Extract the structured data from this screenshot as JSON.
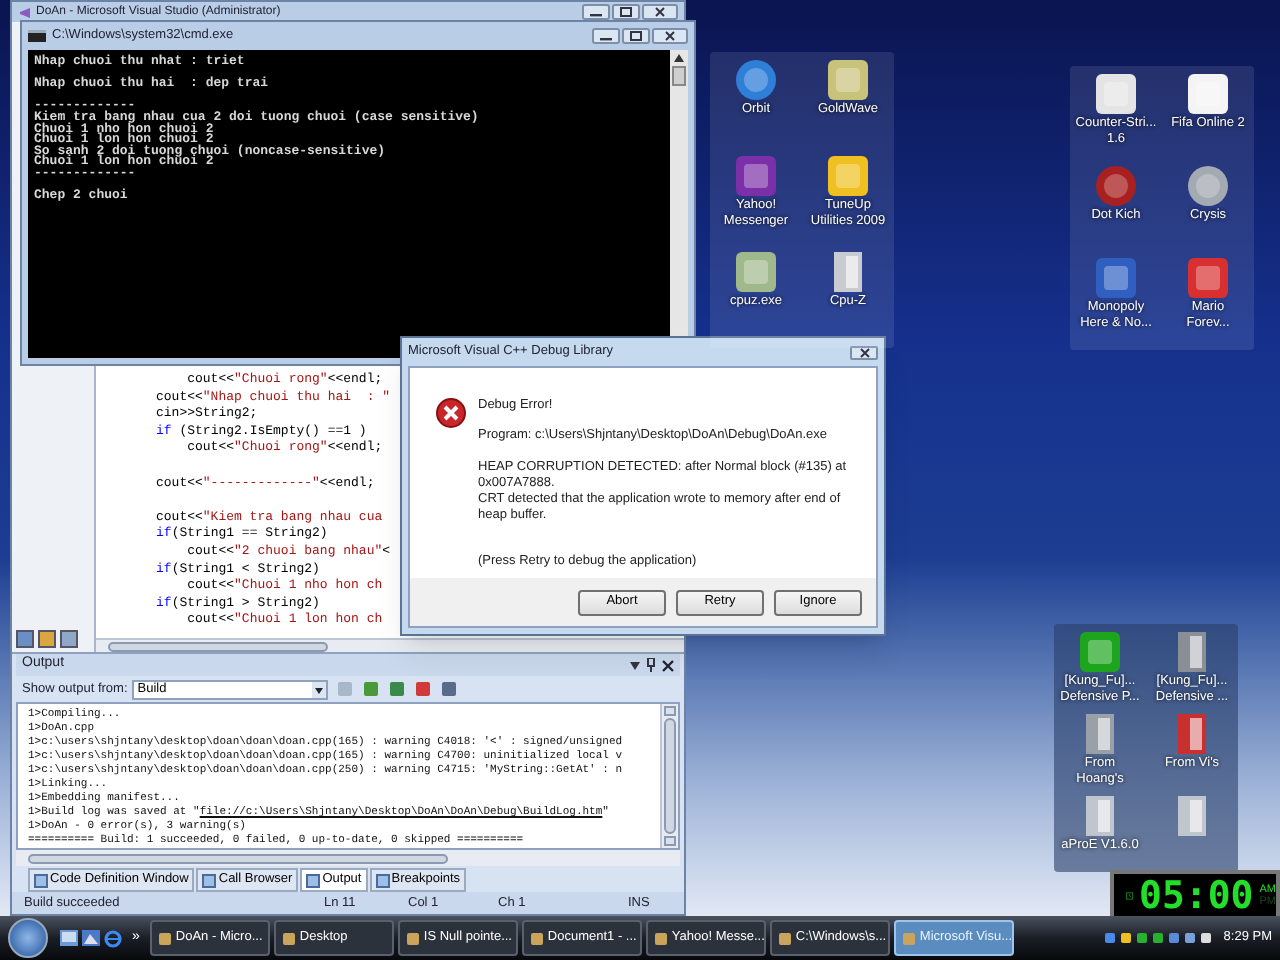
{
  "ide_window": {
    "title": "DoAn - Microsoft Visual Studio (Administrator)",
    "editor": {
      "blocks": [
        [
          [
            {
              "kind": "plain",
              "text": "    cout<<"
            },
            {
              "kind": "string",
              "text": "\"Chuoi rong\""
            },
            {
              "kind": "plain",
              "text": "<<endl;"
            }
          ],
          [
            {
              "kind": "plain",
              "text": "cout<<"
            },
            {
              "kind": "string",
              "text": "\"Nhap chuoi thu hai  : \""
            }
          ],
          [
            {
              "kind": "plain",
              "text": "cin>>String2;"
            }
          ],
          [
            {
              "kind": "keyword",
              "text": "if"
            },
            {
              "kind": "plain",
              "text": " (String2.IsEmpty() ==1 )"
            }
          ],
          [
            {
              "kind": "plain",
              "text": "    cout<<"
            },
            {
              "kind": "string",
              "text": "\"Chuoi rong\""
            },
            {
              "kind": "plain",
              "text": "<<endl;"
            }
          ]
        ],
        [
          [
            {
              "kind": "plain",
              "text": "cout<<"
            },
            {
              "kind": "string",
              "text": "\"-------------\""
            },
            {
              "kind": "plain",
              "text": "<<endl;"
            }
          ]
        ],
        [
          [
            {
              "kind": "plain",
              "text": "cout<<"
            },
            {
              "kind": "string",
              "text": "\"Kiem tra bang nhau cua"
            }
          ],
          [
            {
              "kind": "keyword",
              "text": "if"
            },
            {
              "kind": "plain",
              "text": "(String1 == String2)"
            }
          ],
          [
            {
              "kind": "plain",
              "text": "    cout<<"
            },
            {
              "kind": "string",
              "text": "\"2 chuoi bang nhau\""
            },
            {
              "kind": "plain",
              "text": "<"
            }
          ],
          [
            {
              "kind": "keyword",
              "text": "if"
            },
            {
              "kind": "plain",
              "text": "(String1 < String2)"
            }
          ],
          [
            {
              "kind": "plain",
              "text": "    cout<<"
            },
            {
              "kind": "string",
              "text": "\"Chuoi 1 nho hon ch"
            }
          ],
          [
            {
              "kind": "keyword",
              "text": "if"
            },
            {
              "kind": "plain",
              "text": "(String1 > String2)"
            }
          ],
          [
            {
              "kind": "plain",
              "text": "    cout<<"
            },
            {
              "kind": "string",
              "text": "\"Chuoi 1 lon hon ch"
            }
          ]
        ]
      ]
    },
    "output": {
      "title": "Output",
      "source_label": "Show output from:",
      "source": "Build",
      "lines": [
        {
          "kind": "text",
          "text": "1>Compiling..."
        },
        {
          "kind": "text",
          "text": "1>DoAn.cpp"
        },
        {
          "kind": "text",
          "text": "1>c:\\users\\shjntany\\desktop\\doan\\doan\\doan.cpp(165) : warning C4018: '<' : signed/unsigned"
        },
        {
          "kind": "text",
          "text": "1>c:\\users\\shjntany\\desktop\\doan\\doan\\doan.cpp(165) : warning C4700: uninitialized local v"
        },
        {
          "kind": "text",
          "text": "1>c:\\users\\shjntany\\desktop\\doan\\doan\\doan.cpp(250) : warning C4715: 'MyString::GetAt' : n"
        },
        {
          "kind": "text",
          "text": "1>Linking..."
        },
        {
          "kind": "text",
          "text": "1>Embedding manifest..."
        },
        {
          "kind": "link",
          "prefix": "1>Build log was saved at \"",
          "link": "file://c:\\Users\\Shjntany\\Desktop\\DoAn\\DoAn\\Debug\\BuildLog.htm",
          "suffix": "\""
        },
        {
          "kind": "text",
          "text": "1>DoAn - 0 error(s), 3 warning(s)"
        },
        {
          "kind": "text",
          "text": "========== Build: 1 succeeded, 0 failed, 0 up-to-date, 0 skipped =========="
        }
      ],
      "tabs": [
        {
          "label": "Code Definition Window",
          "selected": false
        },
        {
          "label": "Call Browser",
          "selected": false
        },
        {
          "label": "Output",
          "selected": true
        },
        {
          "label": "Breakpoints",
          "selected": false
        }
      ]
    },
    "status_bar": [
      "Build succeeded",
      "Ln 11",
      "Col 1",
      "Ch 1",
      "INS"
    ]
  },
  "console": {
    "title": "C:\\Windows\\system32\\cmd.exe",
    "blocks": [
      [
        "Nhap chuoi thu nhat : triet"
      ],
      [
        "Nhap chuoi thu hai  : dep trai"
      ],
      [
        "-------------",
        "Kiem tra bang nhau cua 2 doi tuong chuoi (case sensitive)",
        "Chuoi 1 nho hon chuoi 2",
        "Chuoi 1 lon hon chuoi 2",
        "So sanh 2 doi tuong chuoi (noncase-sensitive)",
        "Chuoi 1 lon hon chuoi 2",
        "-------------"
      ],
      [
        "Chep 2 chuoi"
      ]
    ]
  },
  "dialog": {
    "title": "Microsoft Visual C++ Debug Library",
    "heading": "Debug Error!",
    "program": "Program: c:\\Users\\Shjntany\\Desktop\\DoAn\\Debug\\DoAn.exe",
    "message": [
      "HEAP CORRUPTION DETECTED: after Normal block (#135) at 0x007A7888.",
      "CRT detected that the application wrote to memory after end of heap buffer."
    ],
    "hint": "(Press Retry to debug the application)",
    "buttons": [
      "Abort",
      "Retry",
      "Ignore"
    ]
  },
  "desktop_groups": [
    {
      "items": [
        {
          "label": "Orbit",
          "kind": "circle",
          "color": "#2f7fd8"
        },
        {
          "label": "GoldWave",
          "kind": "tile",
          "color": "#c9c27a"
        },
        {
          "label": "Yahoo!\nMessenger",
          "kind": "tile",
          "color": "#7b2fa8"
        },
        {
          "label": "TuneUp\nUtilities 2009",
          "kind": "tile",
          "color": "#f0c020"
        },
        {
          "label": "cpuz.exe",
          "kind": "tile",
          "color": "#9fb98a"
        },
        {
          "label": "Cpu-Z",
          "kind": "folder",
          "color": "#c8ccd2"
        }
      ]
    },
    {
      "items": [
        {
          "label": "Counter-Stri...\n1.6",
          "kind": "tile",
          "color": "#e4e4e4"
        },
        {
          "label": "Fifa Online 2",
          "kind": "tile",
          "color": "#f4f4f4"
        },
        {
          "label": "Dot Kich",
          "kind": "circle",
          "color": "#a82020"
        },
        {
          "label": "Crysis",
          "kind": "circle",
          "color": "#a4aab2"
        },
        {
          "label": "Monopoly\nHere & No...",
          "kind": "tile",
          "color": "#2f5fc0"
        },
        {
          "label": "Mario\nForev...",
          "kind": "tile",
          "color": "#d83030"
        }
      ]
    },
    {
      "items": [
        {
          "label": "[Kung_Fu]...\nDefensive P...",
          "kind": "tile",
          "color": "#1ea51e"
        },
        {
          "label": "[Kung_Fu]...\nDefensive ...",
          "kind": "folder",
          "color": "#8a8f96"
        },
        {
          "label": "From\nHoang's",
          "kind": "folder",
          "color": "#9aa0a8"
        },
        {
          "label": "From Vi's",
          "kind": "folder",
          "color": "#c83030"
        },
        {
          "label": "aProE V1.6.0",
          "kind": "folder",
          "color": "#c0c6ce"
        },
        {
          "kind": "folder",
          "color": "#c0c6ce"
        }
      ]
    }
  ],
  "clock": {
    "time": "05:00",
    "periods": [
      {
        "label": "AM",
        "selected": true
      },
      {
        "label": "PM",
        "selected": false
      }
    ]
  },
  "taskbar": {
    "more": "»",
    "buttons": [
      {
        "label": "DoAn - Micro...",
        "selected": false
      },
      {
        "label": "Desktop",
        "selected": false
      },
      {
        "label": "IS Null pointe...",
        "selected": false
      },
      {
        "label": "Document1 - ...",
        "selected": false
      },
      {
        "label": "Yahoo! Messe...",
        "selected": false
      },
      {
        "label": "C:\\Windows\\s...",
        "selected": false
      },
      {
        "label": "Microsoft Visu...",
        "selected": true
      }
    ],
    "time": "8:29 PM"
  }
}
